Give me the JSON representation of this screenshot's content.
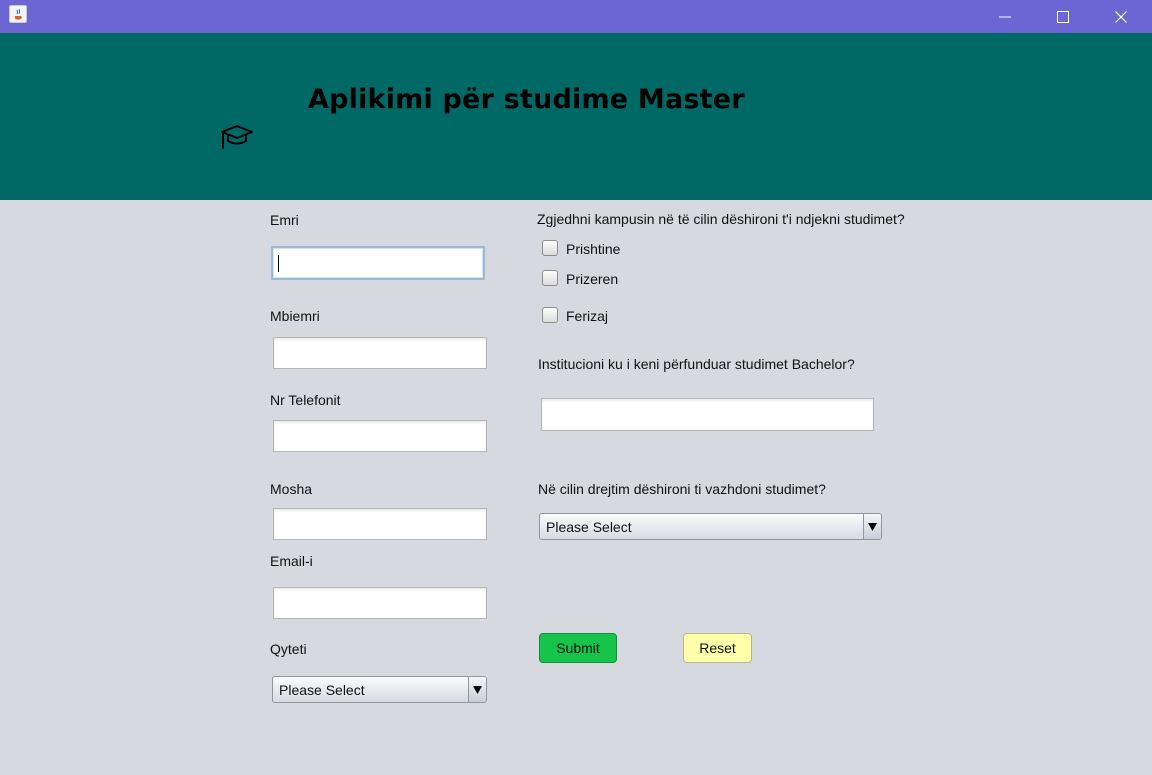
{
  "window": {
    "title": "",
    "controls": {
      "minimize_icon": "minimize-icon",
      "maximize_icon": "maximize-icon",
      "close_icon": "close-icon"
    }
  },
  "header": {
    "title": "Aplikimi për studime Master",
    "icon": "graduation-cap-icon",
    "background": "#006865"
  },
  "form": {
    "emri": {
      "label": "Emri",
      "value": "",
      "placeholder": ""
    },
    "mbiemri": {
      "label": "Mbiemri",
      "value": "",
      "placeholder": ""
    },
    "telefoni": {
      "label": "Nr Telefonit",
      "value": "",
      "placeholder": ""
    },
    "mosha": {
      "label": "Mosha",
      "value": "",
      "placeholder": ""
    },
    "email": {
      "label": "Email-i",
      "value": "",
      "placeholder": ""
    },
    "qyteti": {
      "label": "Qyteti",
      "selected": "Please Select"
    },
    "kampusi": {
      "question": "Zgjedhni kampusin në të cilin dëshironi t'i ndjekni studimet?",
      "options": [
        {
          "label": "Prishtine",
          "checked": false
        },
        {
          "label": "Prizeren",
          "checked": false
        },
        {
          "label": "Ferizaj",
          "checked": false
        }
      ]
    },
    "institucioni": {
      "label": "Institucioni ku i keni përfunduar studimet Bachelor?",
      "value": ""
    },
    "drejtimi": {
      "label": "Në cilin drejtim dëshironi ti vazhdoni studimet?",
      "selected": "Please Select"
    },
    "buttons": {
      "submit": "Submit",
      "reset": "Reset"
    }
  },
  "colors": {
    "titlebar": "#6b66d4",
    "body": "#d6d9e0",
    "submit": "#16c44b",
    "reset": "#ffffaa"
  }
}
